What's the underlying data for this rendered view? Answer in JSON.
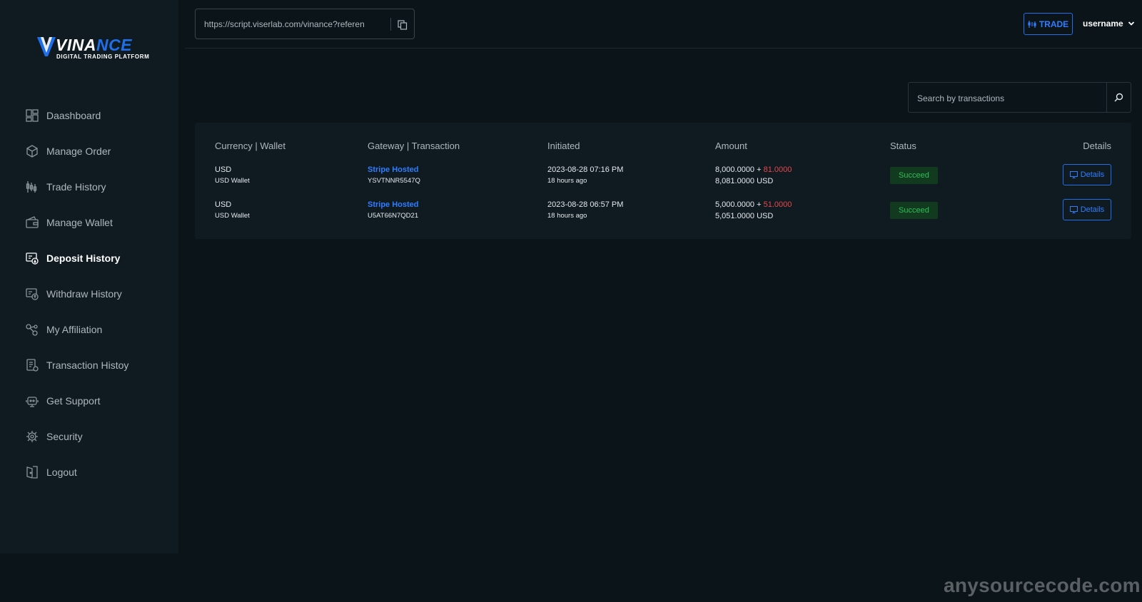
{
  "brand": {
    "name_prefix": "VINA",
    "name_accent": "NCE",
    "tagline": "DIGITAL TRADING PLATFORM"
  },
  "sidebar": {
    "items": [
      {
        "label": "Daashboard",
        "icon": "dashboard-icon",
        "active": false
      },
      {
        "label": "Manage Order",
        "icon": "order-box-icon",
        "active": false
      },
      {
        "label": "Trade History",
        "icon": "candlestick-icon",
        "active": false
      },
      {
        "label": "Manage Wallet",
        "icon": "wallet-icon",
        "active": false
      },
      {
        "label": "Deposit History",
        "icon": "deposit-icon",
        "active": true
      },
      {
        "label": "Withdraw History",
        "icon": "withdraw-icon",
        "active": false
      },
      {
        "label": "My Affiliation",
        "icon": "affiliation-icon",
        "active": false
      },
      {
        "label": "Transaction Histoy",
        "icon": "transaction-icon",
        "active": false
      },
      {
        "label": "Get Support",
        "icon": "support-icon",
        "active": false
      },
      {
        "label": "Security",
        "icon": "security-icon",
        "active": false
      },
      {
        "label": "Logout",
        "icon": "logout-icon",
        "active": false
      }
    ]
  },
  "header": {
    "referral_url": "https://script.viserlab.com/vinance?reference",
    "trade_label": "TRADE",
    "username": "username"
  },
  "search": {
    "placeholder": "Search by transactions"
  },
  "table": {
    "headers": [
      "Currency | Wallet",
      "Gateway | Transaction",
      "Initiated",
      "Amount",
      "Status",
      "Details"
    ],
    "rows": [
      {
        "currency": "USD",
        "wallet": "USD Wallet",
        "gateway": "Stripe Hosted",
        "trx": "YSVTNNR5547Q",
        "initiated": "2023-08-28 07:16 PM",
        "ago": "18 hours ago",
        "amount": "8,000.0000 +",
        "charge": "81.0000",
        "total": "8,081.0000 USD",
        "status": "Succeed",
        "details": "Details"
      },
      {
        "currency": "USD",
        "wallet": "USD Wallet",
        "gateway": "Stripe Hosted",
        "trx": "U5AT66N7QD21",
        "initiated": "2023-08-28 06:57 PM",
        "ago": "18 hours ago",
        "amount": "5,000.0000 +",
        "charge": "51.0000",
        "total": "5,051.0000 USD",
        "status": "Succeed",
        "details": "Details"
      }
    ]
  },
  "watermark": "anysourcecode.com",
  "colors": {
    "background": "#0a1419",
    "sidebar": "#0f1b21",
    "accent": "#1f6feb",
    "success": "#2fbf58",
    "danger": "#e5484d"
  }
}
